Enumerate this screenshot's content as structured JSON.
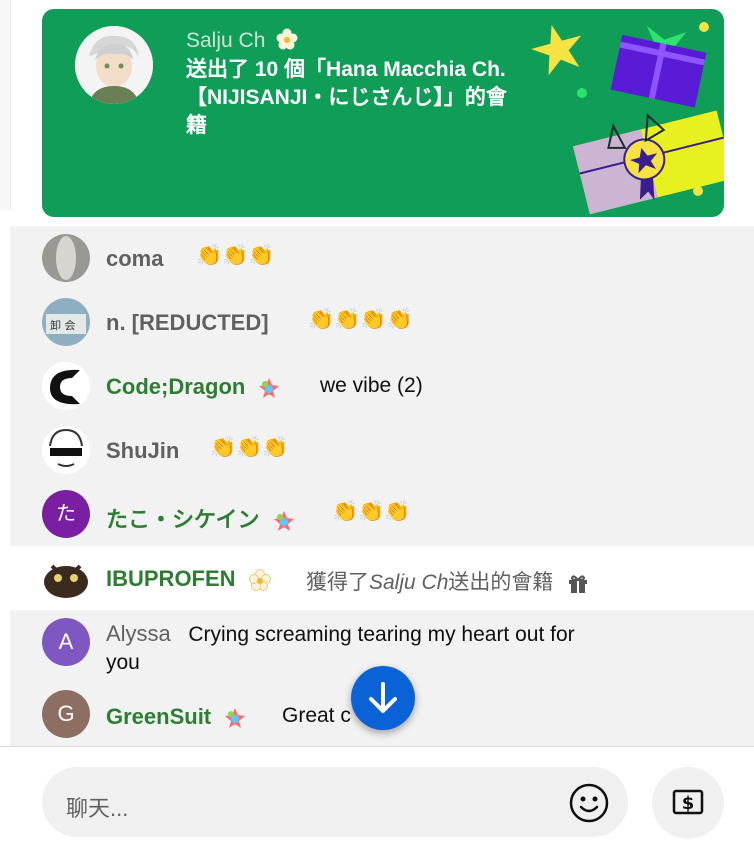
{
  "colors": {
    "gift_bg": "#0f9d58",
    "accent_blue": "#0b62d6",
    "member_green": "#2e7d32"
  },
  "gift": {
    "sender": "Salju Ch",
    "message": "送出了 10 個「Hana Macchia Ch.【NIJISANJI・にじさんじ】」的會籍",
    "icon": "flower-badge-icon"
  },
  "messages": [
    {
      "author": "coma",
      "text": "👏👏👏",
      "member": false
    },
    {
      "author": "n. [REDUCTED]",
      "text": "👏👏👏👏",
      "member": false
    },
    {
      "author": "Code;Dragon",
      "text": "we vibe (2)",
      "member": true
    },
    {
      "author": "ShuJin",
      "text": "👏👏👏",
      "member": false
    },
    {
      "author": "たこ・シケイン",
      "text": "👏👏👏",
      "member": true,
      "avatar_letter": "た"
    },
    {
      "author": "IBUPROFEN",
      "text_prefix": "獲得了",
      "text_sender": "Salju Ch",
      "text_suffix": "送出的會籍",
      "member": true,
      "icon": "gift-icon"
    },
    {
      "author": "Alyssa",
      "text": "Crying screaming tearing my heart out for",
      "text2": "you",
      "member": false,
      "avatar_letter": "A"
    },
    {
      "author": "GreenSuit",
      "text": "Great c",
      "member": true,
      "avatar_letter": "G"
    }
  ],
  "input": {
    "placeholder": "聊天..."
  }
}
